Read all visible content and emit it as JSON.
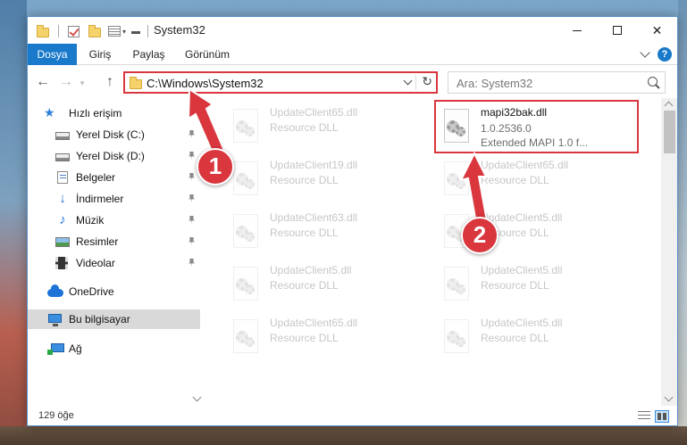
{
  "window": {
    "title": "System32"
  },
  "ribbon": {
    "tabs": [
      {
        "label": "Dosya",
        "active": true
      },
      {
        "label": "Giriş",
        "active": false
      },
      {
        "label": "Paylaş",
        "active": false
      },
      {
        "label": "Görünüm",
        "active": false
      }
    ],
    "help_label": "?"
  },
  "address": {
    "path": "C:\\Windows\\System32",
    "refresh_glyph": "↻"
  },
  "search": {
    "placeholder": "Ara: System32"
  },
  "nav": {
    "back_glyph": "←",
    "forward_glyph": "→",
    "up_glyph": "↑"
  },
  "sidebar": {
    "items": [
      {
        "label": "Hızlı erişim",
        "icon": "star-icon",
        "pinned": false
      },
      {
        "label": "Yerel Disk (C:)",
        "icon": "drive-icon",
        "pinned": true
      },
      {
        "label": "Yerel Disk (D:)",
        "icon": "drive-icon",
        "pinned": true
      },
      {
        "label": "Belgeler",
        "icon": "documents-icon",
        "pinned": true
      },
      {
        "label": "İndirmeler",
        "icon": "download-icon",
        "pinned": true
      },
      {
        "label": "Müzik",
        "icon": "music-icon",
        "pinned": true
      },
      {
        "label": "Resimler",
        "icon": "pictures-icon",
        "pinned": true
      },
      {
        "label": "Videolar",
        "icon": "videos-icon",
        "pinned": true
      },
      {
        "label": "OneDrive",
        "icon": "cloud-icon",
        "pinned": false
      },
      {
        "label": "Bu bilgisayar",
        "icon": "computer-icon",
        "pinned": false,
        "selected": true
      },
      {
        "label": "Ağ",
        "icon": "network-icon",
        "pinned": false
      }
    ]
  },
  "files": {
    "left_column": [
      {
        "name": "UpdateClient65.dll",
        "type": "Resource DLL"
      },
      {
        "name": "UpdateClient19.dll",
        "type": "Resource DLL"
      },
      {
        "name": "UpdateClient63.dll",
        "type": "Resource DLL"
      },
      {
        "name": "UpdateClient5.dll",
        "type": "Resource DLL"
      },
      {
        "name": "UpdateClient65.dll",
        "type": "Resource DLL"
      }
    ],
    "right_column": [
      {
        "name": "UpdateClient65.dll",
        "type": "Resource DLL"
      },
      {
        "name": "UpdateClient5.dll",
        "type": "Resource DLL"
      },
      {
        "name": "UpdateClient5.dll",
        "type": "Resource DLL"
      },
      {
        "name": "UpdateClient5.dll",
        "type": "Resource DLL"
      }
    ],
    "highlighted": {
      "name": "mapi32bak.dll",
      "version": "1.0.2536.0",
      "description": "Extended MAPI 1.0 f..."
    }
  },
  "status": {
    "item_count": "129 öğe"
  },
  "callouts": [
    "1",
    "2"
  ],
  "colors": {
    "accent": "#1979ca",
    "highlight": "#d9363e"
  }
}
